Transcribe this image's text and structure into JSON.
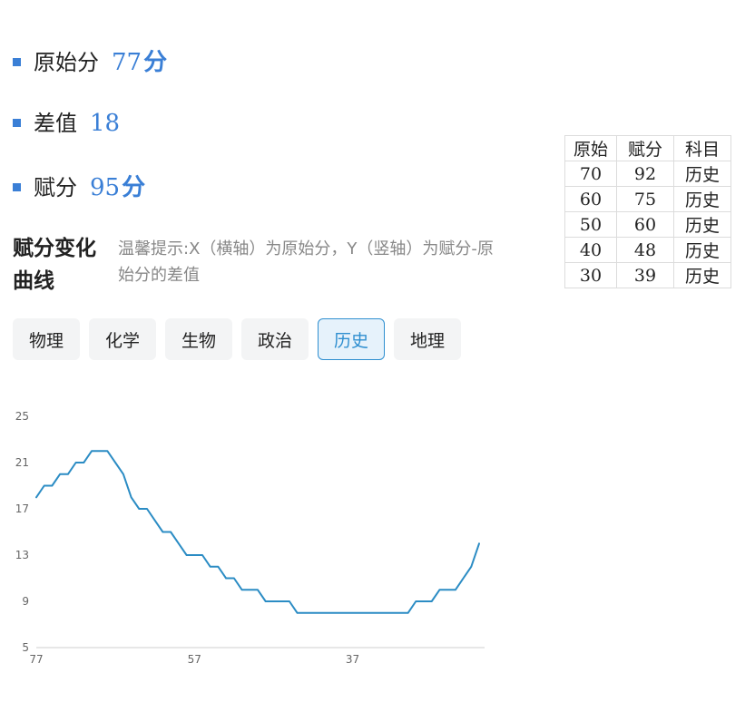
{
  "stats": {
    "raw_label": "原始分",
    "raw_value": "77",
    "raw_unit": "分",
    "diff_label": "差值",
    "diff_value": "18",
    "assigned_label": "赋分",
    "assigned_value": "95",
    "assigned_unit": "分"
  },
  "section": {
    "title": "赋分变化曲线",
    "hint": "温馨提示:X（横轴）为原始分，Y（竖轴）为赋分-原始分的差值"
  },
  "tabs": [
    {
      "label": "物理",
      "active": false
    },
    {
      "label": "化学",
      "active": false
    },
    {
      "label": "生物",
      "active": false
    },
    {
      "label": "政治",
      "active": false
    },
    {
      "label": "历史",
      "active": true
    },
    {
      "label": "地理",
      "active": false
    }
  ],
  "lookup_table": {
    "headers": [
      "原始",
      "赋分",
      "科目"
    ],
    "rows": [
      [
        "70",
        "92",
        "历史"
      ],
      [
        "60",
        "75",
        "历史"
      ],
      [
        "50",
        "60",
        "历史"
      ],
      [
        "40",
        "48",
        "历史"
      ],
      [
        "30",
        "39",
        "历史"
      ]
    ]
  },
  "colors": {
    "accent": "#3a7fd6",
    "line": "#2b8cc4",
    "active_tab_bg": "#e6f2fb",
    "active_tab_border": "#2f8fd0",
    "hint_text": "#888888"
  },
  "chart_data": {
    "type": "line",
    "x_reversed": true,
    "xlim": [
      77,
      21
    ],
    "ylim": [
      5,
      25
    ],
    "x_ticks": [
      77,
      57,
      37
    ],
    "y_ticks": [
      5,
      9,
      13,
      17,
      21,
      25
    ],
    "grid": false,
    "series": [
      {
        "x": [
          77,
          76,
          75,
          74,
          73,
          72,
          71,
          70,
          69,
          68,
          67,
          66,
          65,
          64,
          63,
          62,
          61,
          60,
          59,
          58,
          57,
          56,
          55,
          54,
          53,
          52,
          51,
          50,
          49,
          48,
          47,
          46,
          45,
          44,
          43,
          42,
          41,
          40,
          39,
          38,
          37,
          36,
          35,
          34,
          33,
          32,
          31,
          30,
          29,
          28,
          27,
          26,
          25,
          24,
          23,
          22,
          21
        ],
        "y": [
          18,
          19,
          19,
          20,
          20,
          21,
          21,
          22,
          22,
          22,
          21,
          20,
          18,
          17,
          17,
          16,
          15,
          15,
          14,
          13,
          13,
          13,
          12,
          12,
          11,
          11,
          10,
          10,
          10,
          9,
          9,
          9,
          9,
          8,
          8,
          8,
          8,
          8,
          8,
          8,
          8,
          8,
          8,
          8,
          8,
          8,
          8,
          8,
          9,
          9,
          9,
          10,
          10,
          10,
          11,
          12,
          14
        ]
      }
    ]
  }
}
